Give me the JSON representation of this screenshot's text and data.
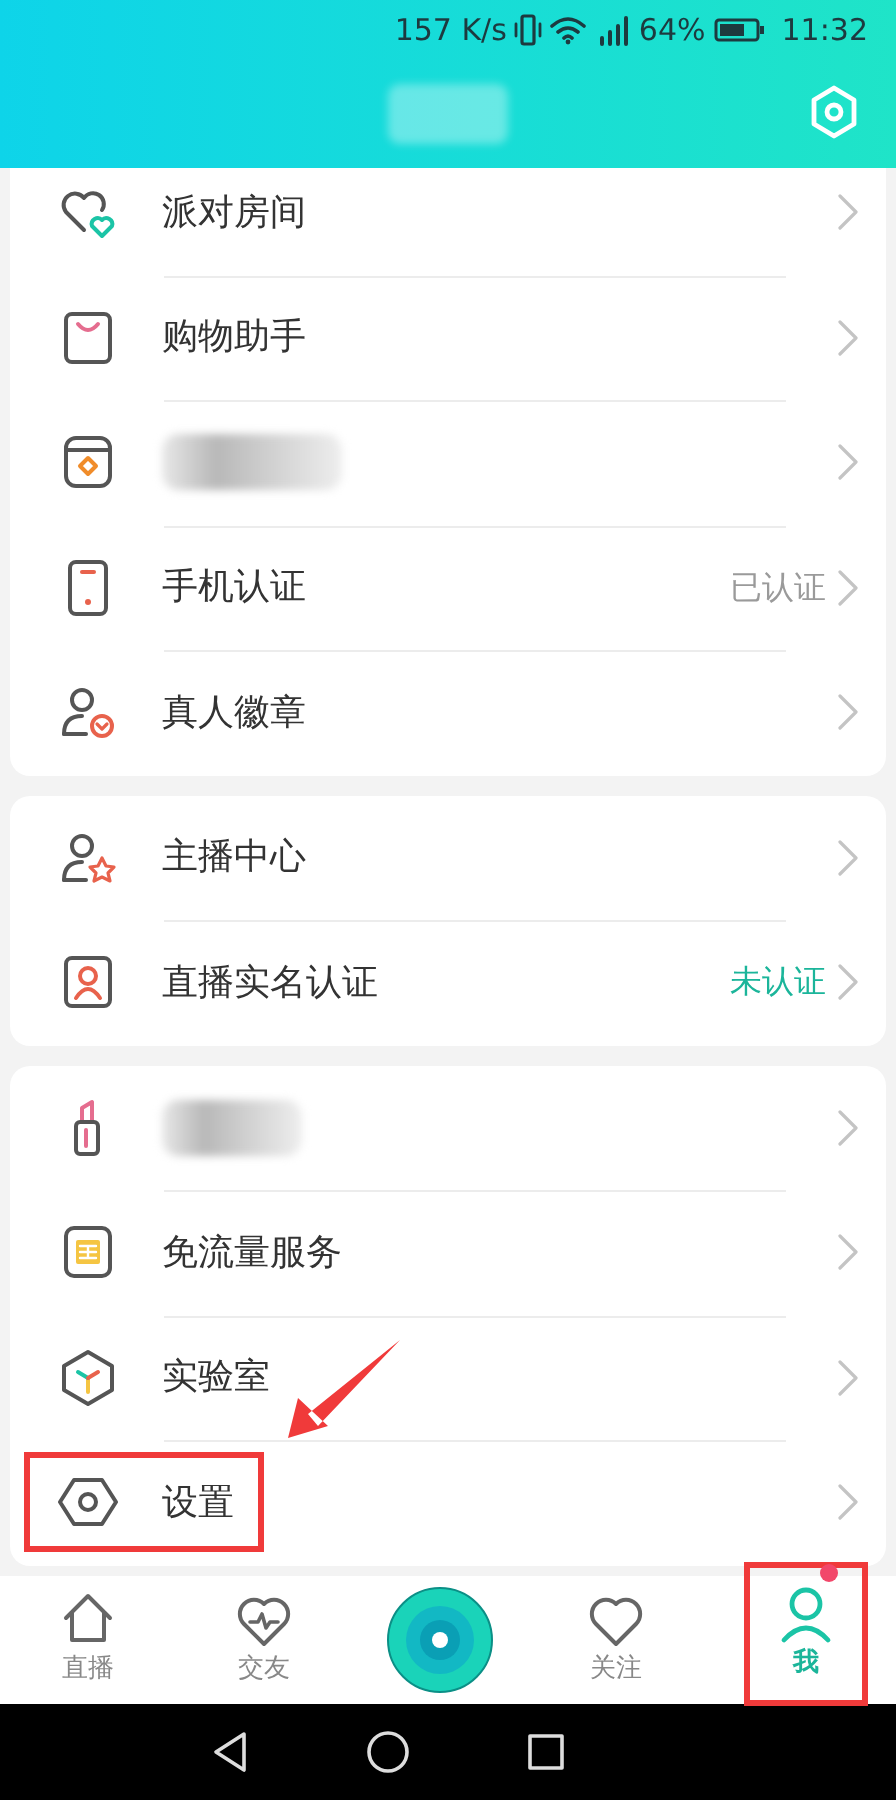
{
  "status_bar": {
    "speed": "157 K/s",
    "battery": "64%",
    "time": "11:32"
  },
  "header": {
    "title_blurred": true
  },
  "sections": [
    {
      "items": [
        {
          "label": "派对房间"
        },
        {
          "label": "购物助手"
        },
        {
          "blurred": true
        },
        {
          "label": "手机认证",
          "value": "已认证",
          "verified": true
        },
        {
          "label": "真人徽章"
        }
      ]
    },
    {
      "items": [
        {
          "label": "主播中心"
        },
        {
          "label": "直播实名认证",
          "value": "未认证",
          "verified": false
        }
      ]
    },
    {
      "items": [
        {
          "blurred": true
        },
        {
          "label": "免流量服务"
        },
        {
          "label": "实验室"
        },
        {
          "label": "设置",
          "highlighted": true
        }
      ]
    }
  ],
  "tabs": [
    {
      "kind": "tab",
      "label": "直播",
      "selected": false
    },
    {
      "kind": "tab",
      "label": "交友",
      "selected": false
    },
    {
      "kind": "center",
      "selected": false
    },
    {
      "kind": "tab",
      "label": "关注",
      "selected": false
    },
    {
      "kind": "tab",
      "label": "我",
      "selected": true,
      "badge": true,
      "highlighted": true
    }
  ]
}
